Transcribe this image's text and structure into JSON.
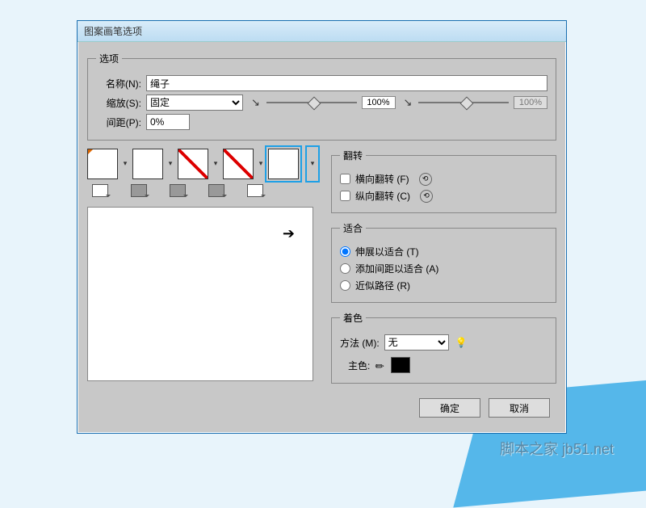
{
  "title": "图案画笔选项",
  "options": {
    "legend": "选项",
    "name_label": "名称(N):",
    "name_value": "绳子",
    "scale_label": "缩放(S):",
    "scale_mode": "固定",
    "scale_value": "100%",
    "scale_value2": "100%",
    "spacing_label": "间距(P):",
    "spacing_value": "0%"
  },
  "flip": {
    "legend": "翻转",
    "h_label": "横向翻转 (F)",
    "v_label": "纵向翻转 (C)"
  },
  "fit": {
    "legend": "适合",
    "stretch": "伸展以适合 (T)",
    "space": "添加间距以适合 (A)",
    "approx": "近似路径 (R)"
  },
  "colorize": {
    "legend": "着色",
    "method_label": "方法 (M):",
    "method_value": "无",
    "key_label": "主色:"
  },
  "buttons": {
    "ok": "确定",
    "cancel": "取消"
  },
  "watermark": "脚本之家 jb51.net"
}
